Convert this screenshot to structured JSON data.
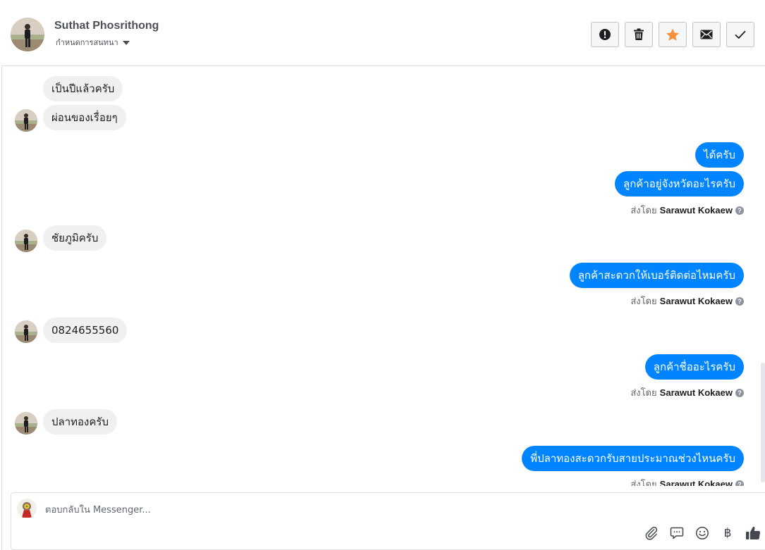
{
  "conversation": {
    "contact_name": "Suthat Phosrithong",
    "subtitle": "กำหนดการสนทนา"
  },
  "header_actions": [
    {
      "name": "spam",
      "icon": "exclamation-circle-icon"
    },
    {
      "name": "delete",
      "icon": "trash-icon"
    },
    {
      "name": "star",
      "icon": "star-icon",
      "color": "#f7923b"
    },
    {
      "name": "mark-unread",
      "icon": "envelope-icon"
    },
    {
      "name": "done",
      "icon": "check-icon"
    }
  ],
  "messages": [
    {
      "dir": "in",
      "text": "เป็นปีแล้วครับ"
    },
    {
      "dir": "in",
      "text": "ผ่อนของเรื่อยๆ"
    },
    {
      "dir": "out",
      "text": "ได้ครับ"
    },
    {
      "dir": "out",
      "text": "ลูกค้าอยู่จังหวัดอะไรครับ"
    },
    {
      "dir": "in",
      "text": "ชัยภูมิครับ"
    },
    {
      "dir": "out",
      "text": "ลูกค้าสะดวกให้เบอร์ติดต่อไหมครับ"
    },
    {
      "dir": "in",
      "text": "0824655560"
    },
    {
      "dir": "out",
      "text": "ลูกค้าชื่ออะไรครับ"
    },
    {
      "dir": "in",
      "text": "ปลาทองครับ"
    },
    {
      "dir": "out",
      "text": "พี่ปลาทองสะดวกรับสายประมาณช่วงไหนครับ"
    }
  ],
  "sent_by": {
    "prefix": "ส่งโดย",
    "agent": "Sarawut Kokaew",
    "help_glyph": "?"
  },
  "composer": {
    "placeholder": "ตอบกลับใน Messenger...",
    "tools": [
      {
        "name": "attach",
        "icon": "paperclip-icon"
      },
      {
        "name": "saved-replies",
        "icon": "chat-bubble-icon"
      },
      {
        "name": "emoji",
        "icon": "smiley-icon"
      },
      {
        "name": "payment",
        "icon": "baht-icon",
        "glyph": "฿"
      },
      {
        "name": "like",
        "icon": "thumbs-up-icon"
      }
    ]
  },
  "colors": {
    "outgoing_bubble": "#0084ff",
    "incoming_bubble": "#f1f0f0",
    "star": "#f7923b"
  }
}
